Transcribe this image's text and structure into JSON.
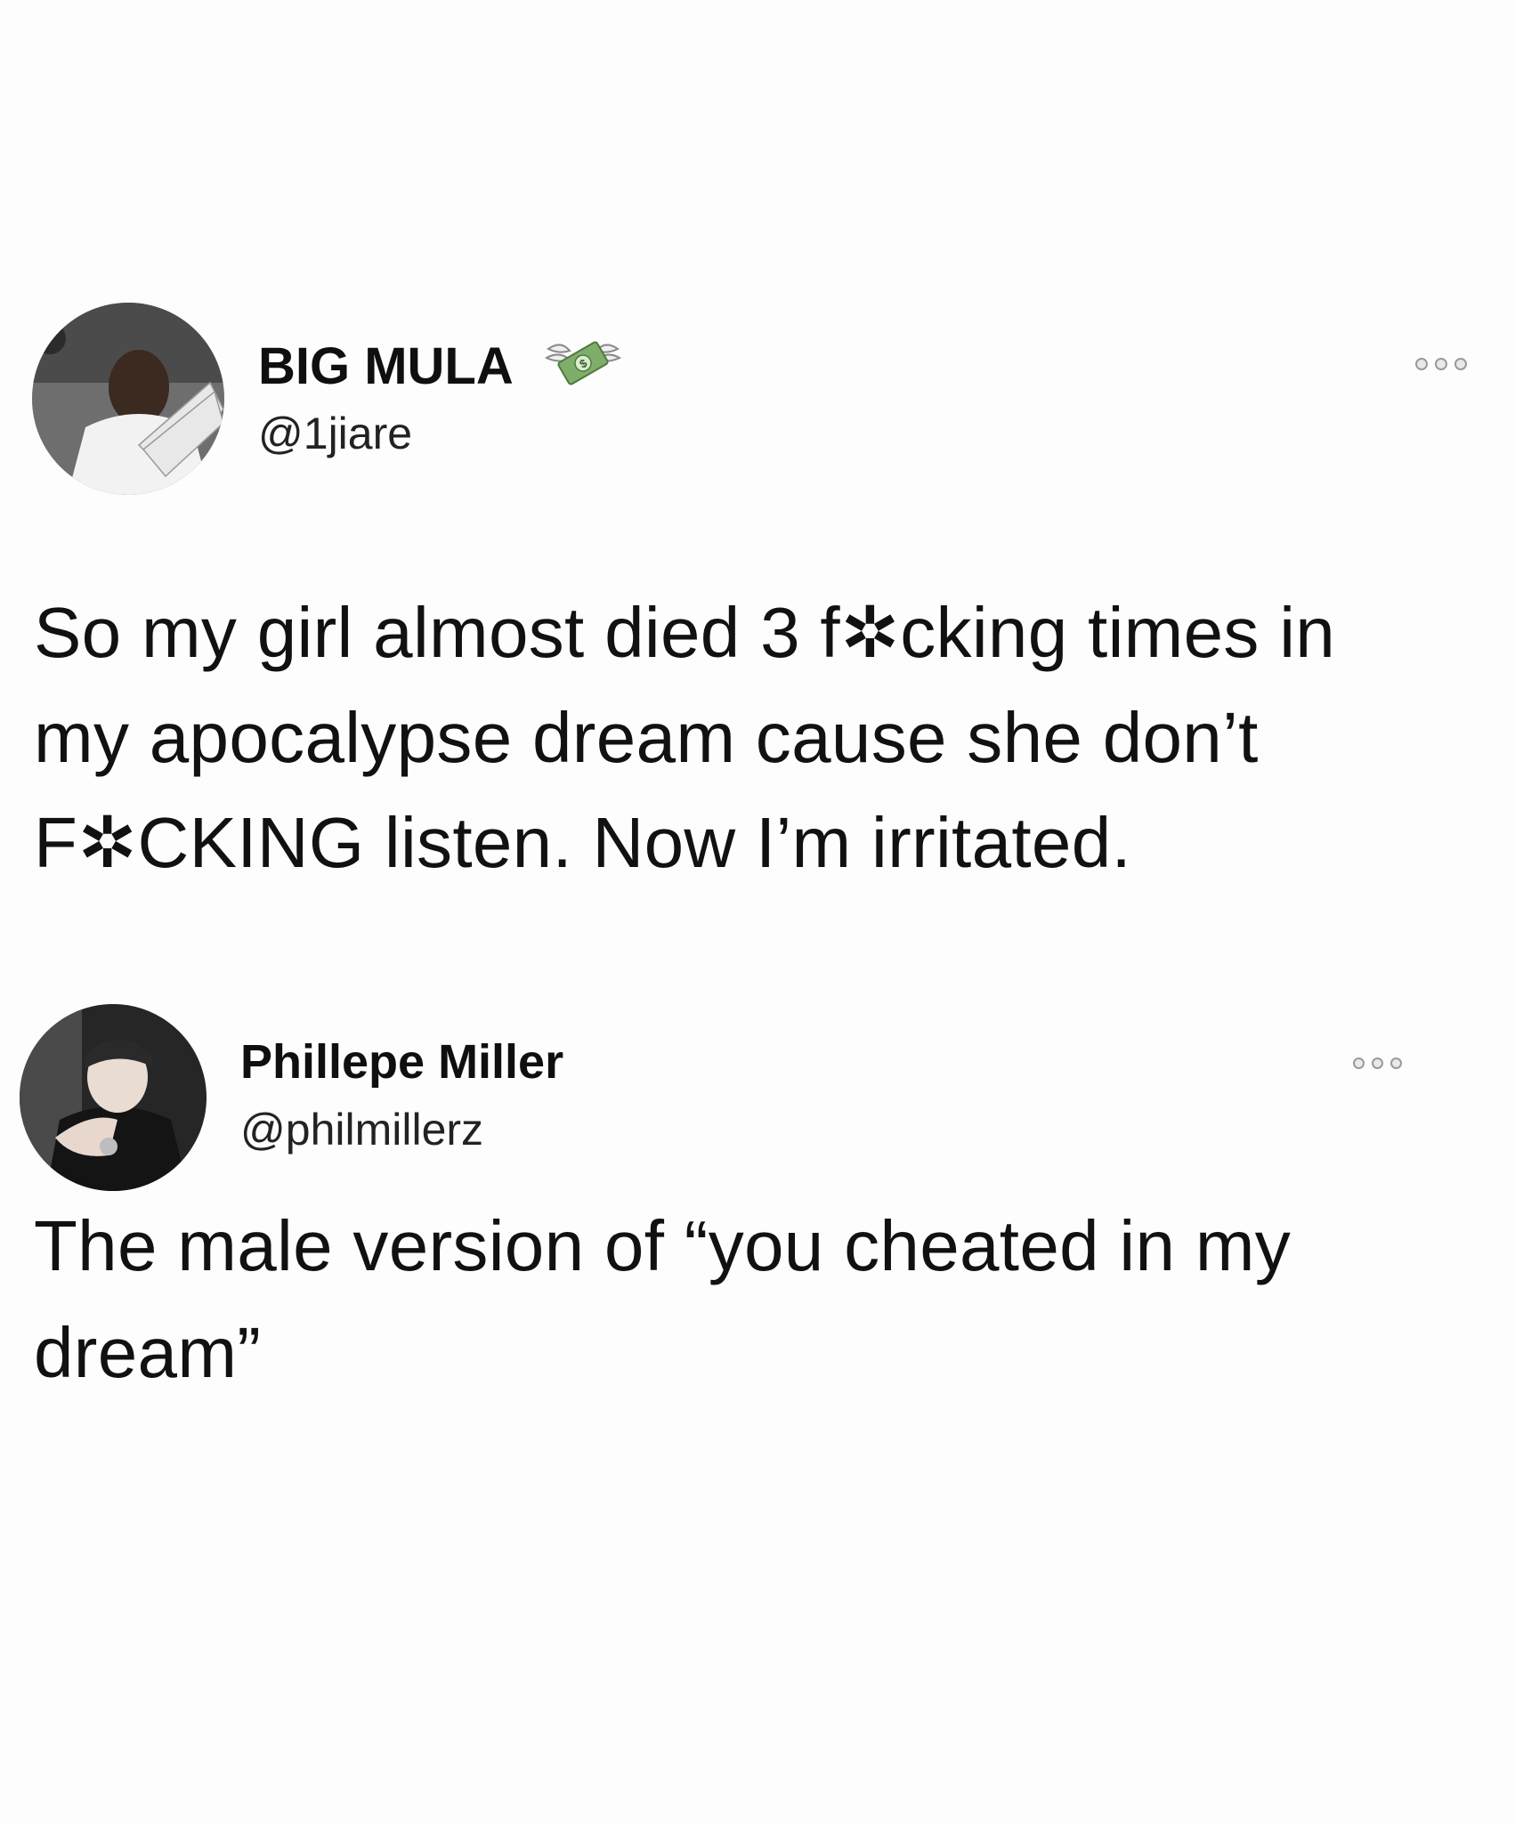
{
  "tweets": [
    {
      "display_name": "BIG MULA",
      "handle": "@1jiare",
      "badge_icon": "money-with-wings-icon",
      "text_lines": [
        "So my girl almost died 3 f✲cking times in",
        "my apocalypse dream cause she don’t",
        "F✲CKING listen. Now I’m irritated."
      ]
    },
    {
      "display_name": "Phillepe Miller",
      "handle": "@philmillerz",
      "text_lines": [
        "The male version of “you cheated in my",
        "dream”"
      ]
    }
  ],
  "colors": {
    "background": "#fdfdfd",
    "text": "#111111",
    "money_green": "#7fae6a"
  }
}
